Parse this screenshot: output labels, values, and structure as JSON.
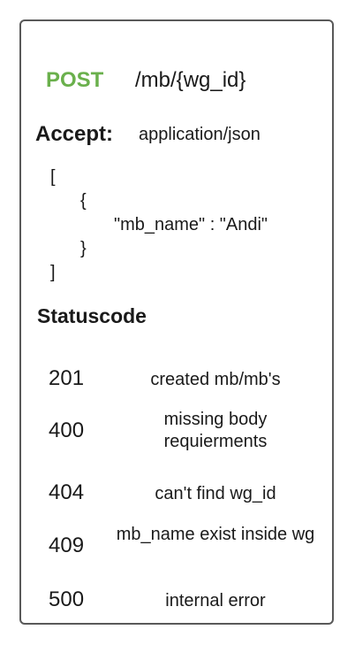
{
  "endpoint": {
    "method": "POST",
    "method_color": "#6ab04c",
    "path": "/mb/{wg_id}"
  },
  "accept": {
    "label": "Accept:",
    "value": "application/json"
  },
  "body_example": {
    "open_bracket": "[",
    "open_brace": "{",
    "field": "\"mb_name\" : \"Andi\"",
    "close_brace": "}",
    "close_bracket": "]"
  },
  "status": {
    "heading": "Statuscode",
    "rows": [
      {
        "code": "201",
        "description": "created mb/mb's"
      },
      {
        "code": "400",
        "description": "missing body requierments"
      },
      {
        "code": "404",
        "description": "can't find wg_id"
      },
      {
        "code": "409",
        "description": "mb_name exist inside wg"
      },
      {
        "code": "500",
        "description": "internal error"
      }
    ]
  }
}
